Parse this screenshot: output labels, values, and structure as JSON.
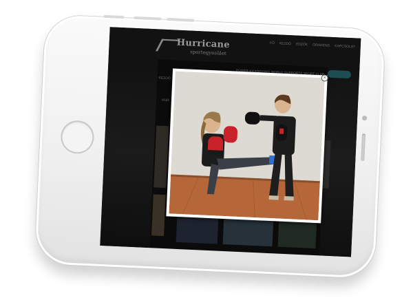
{
  "site": {
    "logo_title": "Hurricane",
    "logo_subtitle": "sportegyesület",
    "nav_items": [
      "FŐ",
      "KEZDŐ",
      "EDZŐK",
      "ÓRAREND",
      "KAPCSOLAT"
    ],
    "tagline": "POWER KICKBOXING WORLD SUPPORTS SPORT CLUB",
    "page_text_1": "KEZDŐ",
    "page_text_2": "HUR"
  },
  "lightbox": {
    "close_label": "×"
  },
  "colors": {
    "screen_bg": "#0b0b0b",
    "accent_teal": "#1f4e52",
    "glove_red": "#c8232b",
    "floor_wood": "#b5673a"
  }
}
